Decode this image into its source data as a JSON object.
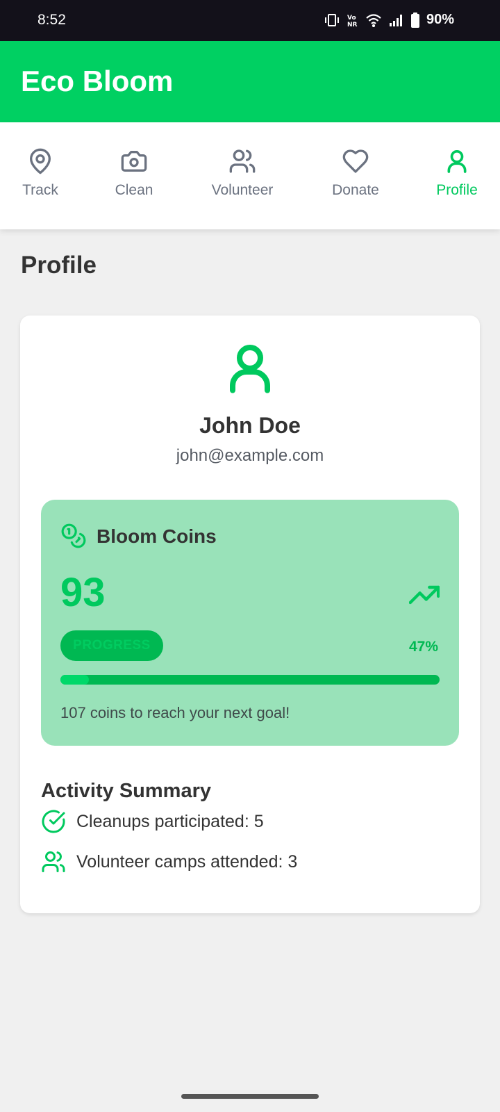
{
  "status": {
    "time": "8:52",
    "battery": "90%"
  },
  "app": {
    "title": "Eco Bloom"
  },
  "tabs": [
    {
      "label": "Track",
      "icon": "map-pin-icon"
    },
    {
      "label": "Clean",
      "icon": "camera-icon"
    },
    {
      "label": "Volunteer",
      "icon": "users-icon"
    },
    {
      "label": "Donate",
      "icon": "heart-icon"
    },
    {
      "label": "Profile",
      "icon": "user-icon",
      "active": true
    }
  ],
  "page": {
    "title": "Profile"
  },
  "user": {
    "name": "John Doe",
    "email": "john@example.com"
  },
  "coins": {
    "title": "Bloom Coins",
    "value": "93",
    "progress_label": "PROGRESS",
    "progress_percent": "47%",
    "progress_fraction": 0.075,
    "note": "107 coins to reach your next goal!"
  },
  "activity": {
    "title": "Activity Summary",
    "items": [
      {
        "text": "Cleanups participated: 5",
        "icon": "check-circle-icon"
      },
      {
        "text": "Volunteer camps attended: 3",
        "icon": "users-icon"
      }
    ]
  },
  "colors": {
    "brand": "#00d062",
    "accent": "#00c95e",
    "coins_bg": "#99e2b9",
    "progress": "#00b852"
  }
}
